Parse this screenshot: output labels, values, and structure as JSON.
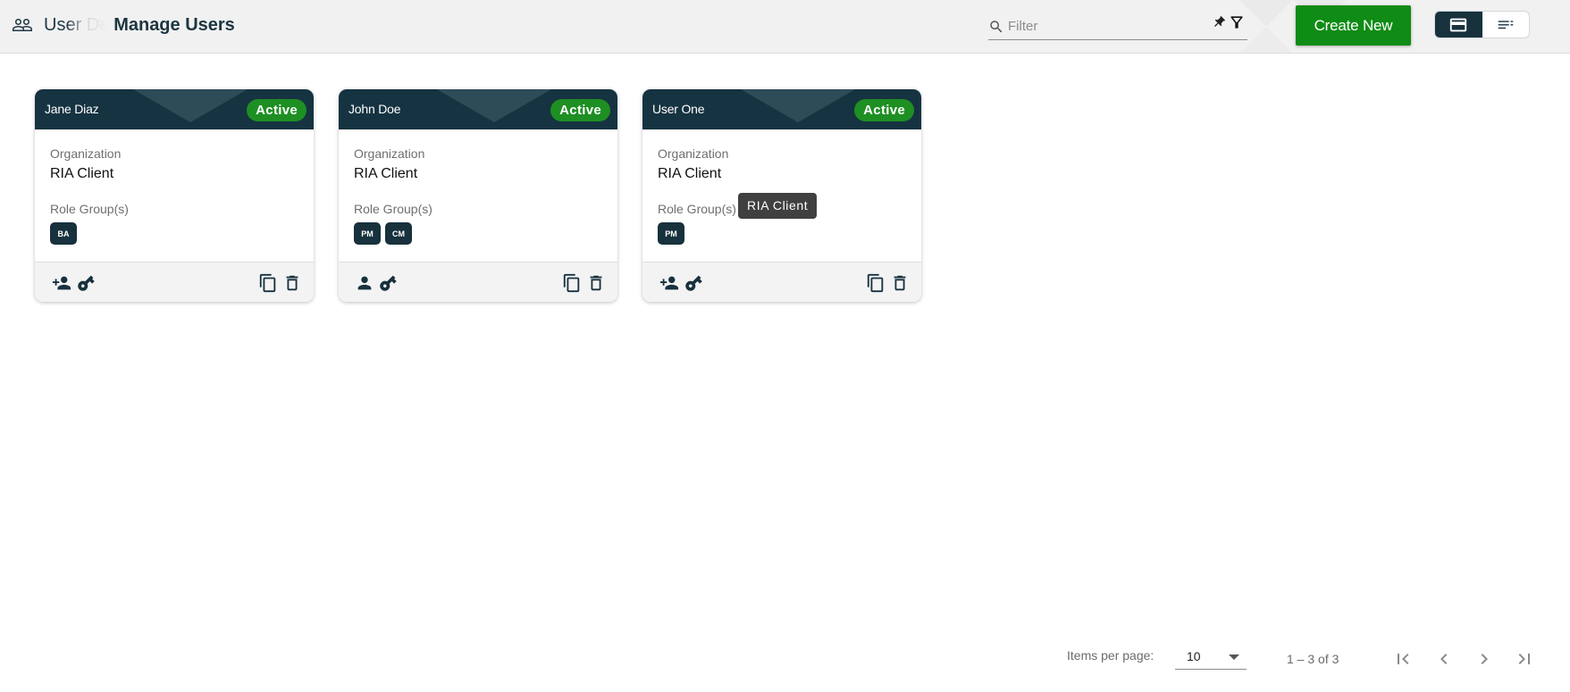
{
  "header": {
    "breadcrumb_parent": "User Dashboard",
    "breadcrumb_separator": ">",
    "breadcrumb_current": "Manage Users",
    "filter_placeholder": "Filter",
    "create_label": "Create New"
  },
  "colors": {
    "primary_dark": "#163341",
    "accent_green": "#0f8c15",
    "status_green": "#1e8f22"
  },
  "cards": [
    {
      "name": "Jane Diaz",
      "status": "Active",
      "org_label": "Organization",
      "org_value": "RIA Client",
      "roles_label": "Role Group(s)",
      "roles": [
        "BA"
      ],
      "left_icons": [
        "person-add-icon",
        "key-icon"
      ],
      "right_icons": [
        "copy-icon",
        "delete-icon"
      ]
    },
    {
      "name": "John Doe",
      "status": "Active",
      "org_label": "Organization",
      "org_value": "RIA Client",
      "roles_label": "Role Group(s)",
      "roles": [
        "PM",
        "CM"
      ],
      "left_icons": [
        "person-icon",
        "key-icon"
      ],
      "right_icons": [
        "copy-icon",
        "delete-icon"
      ]
    },
    {
      "name": "User One",
      "status": "Active",
      "org_label": "Organization",
      "org_value": "RIA Client",
      "roles_label": "Role Group(s)",
      "roles": [
        "PM"
      ],
      "left_icons": [
        "person-add-icon",
        "key-icon"
      ],
      "right_icons": [
        "copy-icon",
        "delete-icon"
      ]
    }
  ],
  "tooltip": "RIA Client",
  "paginator": {
    "items_label": "Items per page:",
    "page_size": "10",
    "range": "1 – 3 of 3"
  }
}
